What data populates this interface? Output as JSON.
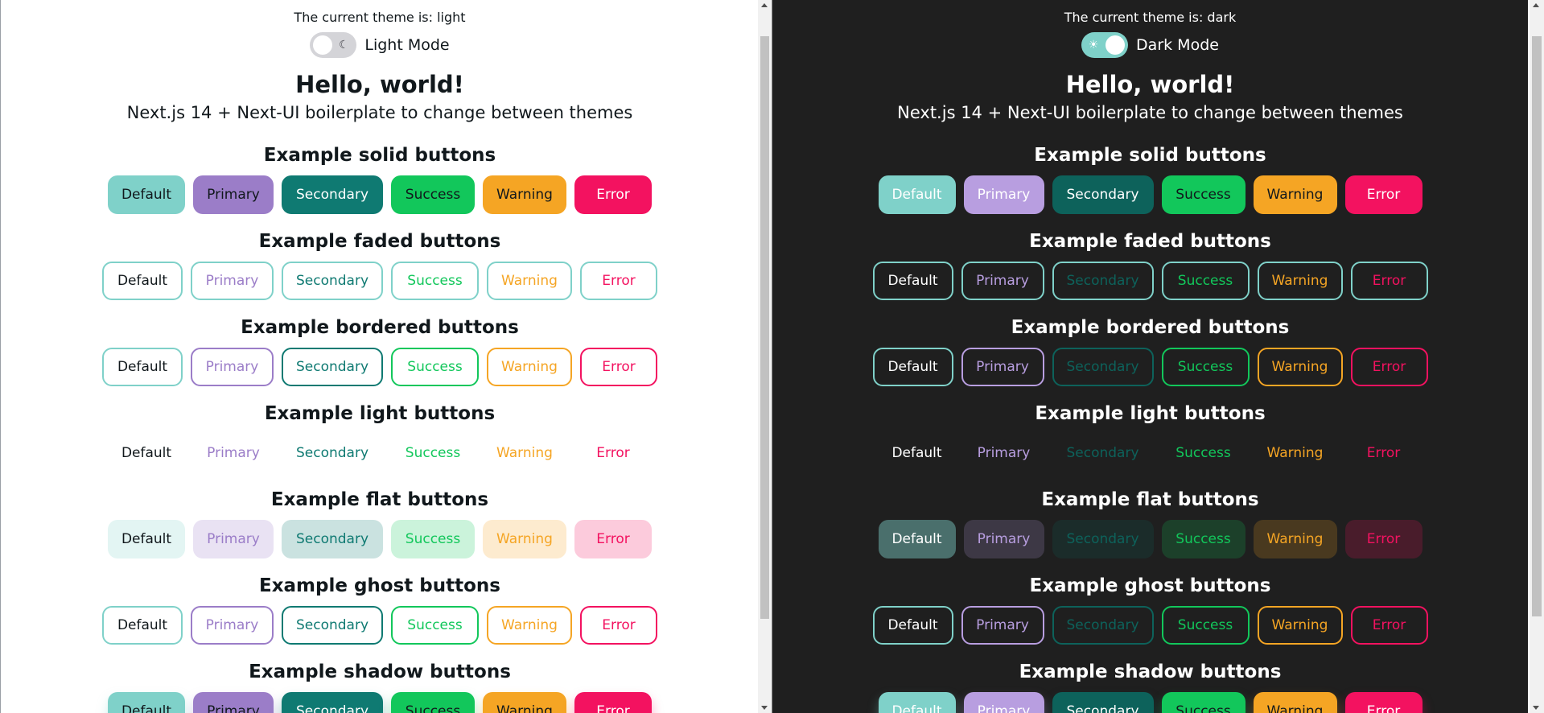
{
  "panes": [
    {
      "theme_text": "The current theme is: light",
      "mode_label": "Light Mode",
      "toggle_icon": "moon-icon",
      "hello": "Hello, world!",
      "subtitle": "Next.js 14 + Next-UI boilerplate to change between themes",
      "sections": [
        {
          "title": "Example solid buttons",
          "variant": "solid"
        },
        {
          "title": "Example faded buttons",
          "variant": "faded"
        },
        {
          "title": "Example bordered buttons",
          "variant": "bordered"
        },
        {
          "title": "Example light buttons",
          "variant": "light"
        },
        {
          "title": "Example flat buttons",
          "variant": "flat"
        },
        {
          "title": "Example ghost buttons",
          "variant": "ghost"
        },
        {
          "title": "Example shadow buttons",
          "variant": "shadow"
        }
      ],
      "buttons": [
        "Default",
        "Primary",
        "Secondary",
        "Success",
        "Warning",
        "Error"
      ]
    },
    {
      "theme_text": "The current theme is: dark",
      "mode_label": "Dark Mode",
      "toggle_icon": "sun-icon",
      "hello": "Hello, world!",
      "subtitle": "Next.js 14 + Next-UI boilerplate to change between themes",
      "sections": [
        {
          "title": "Example solid buttons",
          "variant": "solid"
        },
        {
          "title": "Example faded buttons",
          "variant": "faded"
        },
        {
          "title": "Example bordered buttons",
          "variant": "bordered"
        },
        {
          "title": "Example light buttons",
          "variant": "light"
        },
        {
          "title": "Example flat buttons",
          "variant": "flat"
        },
        {
          "title": "Example ghost buttons",
          "variant": "ghost"
        },
        {
          "title": "Example shadow buttons",
          "variant": "shadow"
        }
      ],
      "buttons": [
        "Default",
        "Primary",
        "Secondary",
        "Success",
        "Warning",
        "Error"
      ]
    }
  ],
  "colors": {
    "default": "#7fd1c9",
    "primary": "#9b7dc8",
    "secondary": "#0f7a72",
    "success": "#12c75b",
    "warning": "#f5a524",
    "error": "#f31260",
    "dark_primary": "#b89ee0",
    "dark_secondary": "#0d625b",
    "dark_default_text": "#ffffff"
  }
}
